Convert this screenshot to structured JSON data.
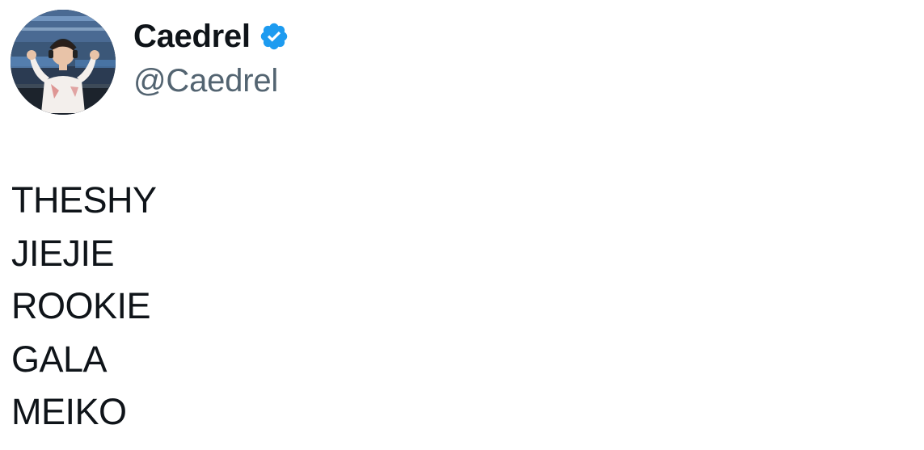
{
  "author": {
    "display_name": "Caedrel",
    "handle": "@Caedrel",
    "verified": true,
    "verified_color": "#1d9bf0",
    "avatar_icon": "profile-photo"
  },
  "tweet": {
    "lines": [
      "THESHY",
      "JIEJIE",
      "ROOKIE",
      "GALA",
      "MEIKO"
    ]
  },
  "colors": {
    "text_primary": "#0f1419",
    "text_secondary": "#536471",
    "background": "#ffffff"
  }
}
